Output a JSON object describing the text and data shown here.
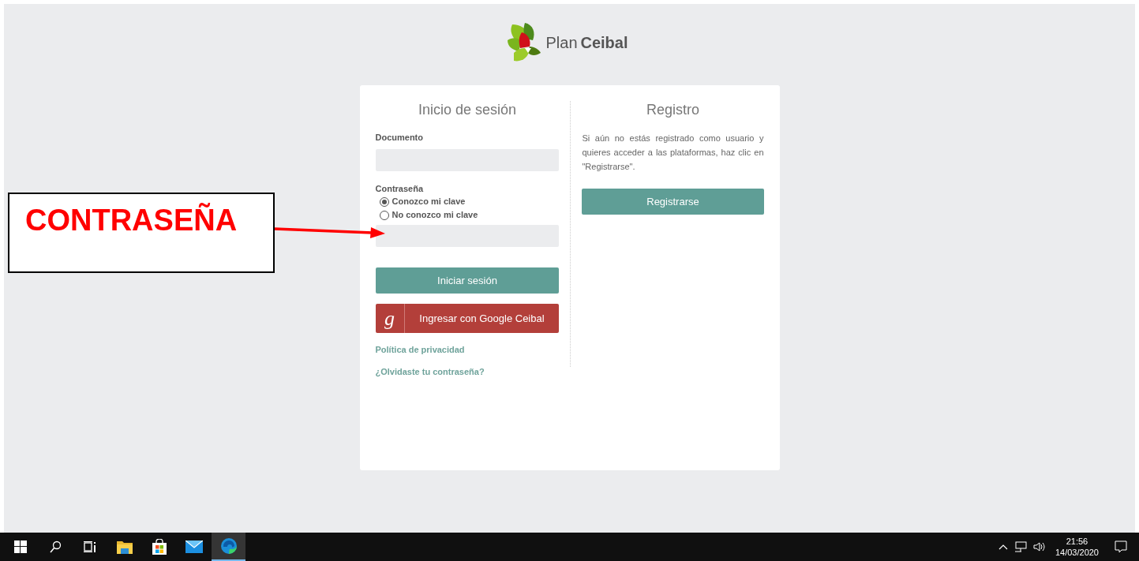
{
  "logo": {
    "words": [
      "Plan",
      "Ceibal"
    ]
  },
  "login": {
    "title": "Inicio de sesión",
    "document_label": "Documento",
    "password_label": "Contraseña",
    "password_options": [
      {
        "label": "Conozco mi clave",
        "selected": true
      },
      {
        "label": "No conozco mi clave",
        "selected": false
      }
    ],
    "submit": "Iniciar sesión",
    "google_icon": "g",
    "google_button": "Ingresar con Google Ceibal",
    "links": [
      "Política de privacidad",
      "¿Olvidaste tu contraseña?"
    ]
  },
  "register": {
    "title": "Registro",
    "text": "Si aún no estás registrado como usuario y quieres acceder a las plataformas, haz clic en \"Registrarse\".",
    "button": "Registrarse"
  },
  "annotation": {
    "text": "CONTRASEÑA"
  },
  "taskbar": {
    "apps": [
      {
        "kind": "start",
        "selected": false
      },
      {
        "kind": "search",
        "selected": false
      },
      {
        "kind": "taskview",
        "selected": false
      },
      {
        "kind": "folder",
        "selected": false
      },
      {
        "kind": "store",
        "selected": false
      },
      {
        "kind": "mail",
        "selected": false
      },
      {
        "kind": "edge",
        "selected": true
      }
    ],
    "time": "21:56",
    "date": "14/03/2020"
  }
}
